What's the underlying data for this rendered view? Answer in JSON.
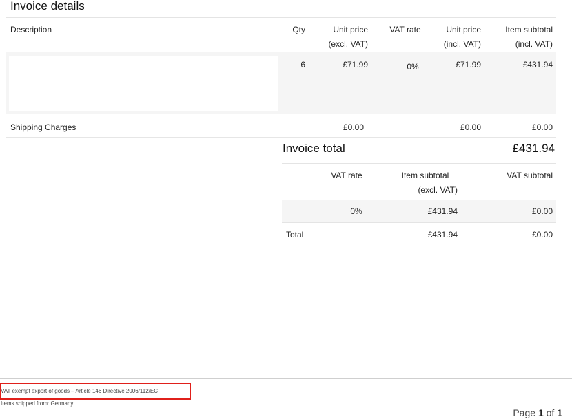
{
  "invoice": {
    "title": "Invoice details",
    "columns": {
      "description": "Description",
      "qty": "Qty",
      "unit_price_excl_line1": "Unit price",
      "unit_price_excl_line2": "(excl. VAT)",
      "vat_rate": "VAT rate",
      "unit_price_incl_line1": "Unit price",
      "unit_price_incl_line2": "(incl. VAT)",
      "item_subtotal_line1": "Item subtotal",
      "item_subtotal_line2": "(incl. VAT)"
    },
    "items": [
      {
        "description": "",
        "qty": "6",
        "unit_price_excl": "£71.99",
        "vat_rate": "0%",
        "unit_price_incl": "£71.99",
        "item_subtotal": "£431.94"
      }
    ],
    "shipping": {
      "label": "Shipping Charges",
      "unit_price_excl": "£0.00",
      "unit_price_incl": "£0.00",
      "item_subtotal": "£0.00"
    },
    "invoice_total": {
      "label": "Invoice total",
      "value": "£431.94"
    },
    "vat_summary": {
      "columns": {
        "vat_rate": "VAT rate",
        "item_subtotal_line1": "Item subtotal",
        "item_subtotal_line2": "(excl. VAT)",
        "vat_subtotal": "VAT subtotal"
      },
      "rows": [
        {
          "vat_rate": "0%",
          "item_subtotal": "£431.94",
          "vat_subtotal": "£0.00"
        }
      ],
      "total": {
        "label": "Total",
        "item_subtotal": "£431.94",
        "vat_subtotal": "£0.00"
      }
    }
  },
  "footer": {
    "vat_note": "VAT exempt export of goods – Article 146 Directive 2006/112/EC",
    "shipped_from": "Items shipped from: Germany",
    "page": {
      "prefix": "Page",
      "current": "1",
      "of": "of",
      "total": "1"
    }
  },
  "colors": {
    "highlight_border": "#e0201b",
    "row_shade": "#f5f5f5"
  }
}
